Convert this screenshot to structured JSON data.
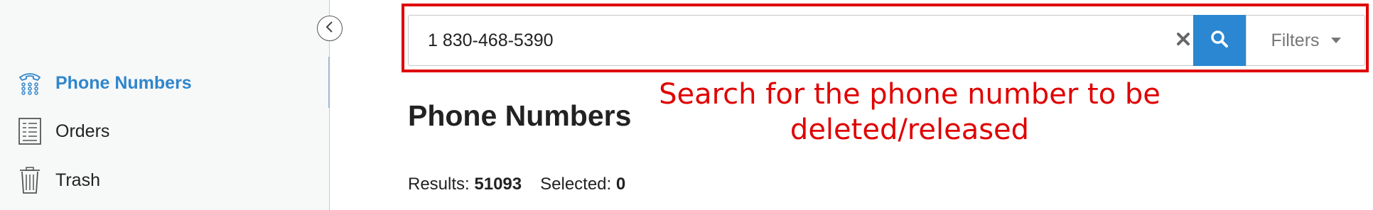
{
  "sidebar": {
    "items": [
      {
        "label": "Phone Numbers",
        "icon": "phone-icon",
        "active": true
      },
      {
        "label": "Orders",
        "icon": "orders-icon",
        "active": false
      },
      {
        "label": "Trash",
        "icon": "trash-icon",
        "active": false
      }
    ],
    "collapse_icon": "chevron-left-icon"
  },
  "search": {
    "value": "1 830-468-5390",
    "clear_icon": "close-icon",
    "search_icon": "search-icon",
    "filters_label": "Filters",
    "filters_icon": "caret-down-icon"
  },
  "main": {
    "title": "Phone Numbers",
    "results_label": "Results:",
    "results_count": "51093",
    "selected_label": "Selected:",
    "selected_count": "0"
  },
  "annotation": {
    "line1": "Search for the phone number to be",
    "line2": "deleted/released"
  },
  "colors": {
    "accent": "#2f86cc",
    "search_button": "#2b87d1",
    "annotation_red": "#e00000"
  }
}
